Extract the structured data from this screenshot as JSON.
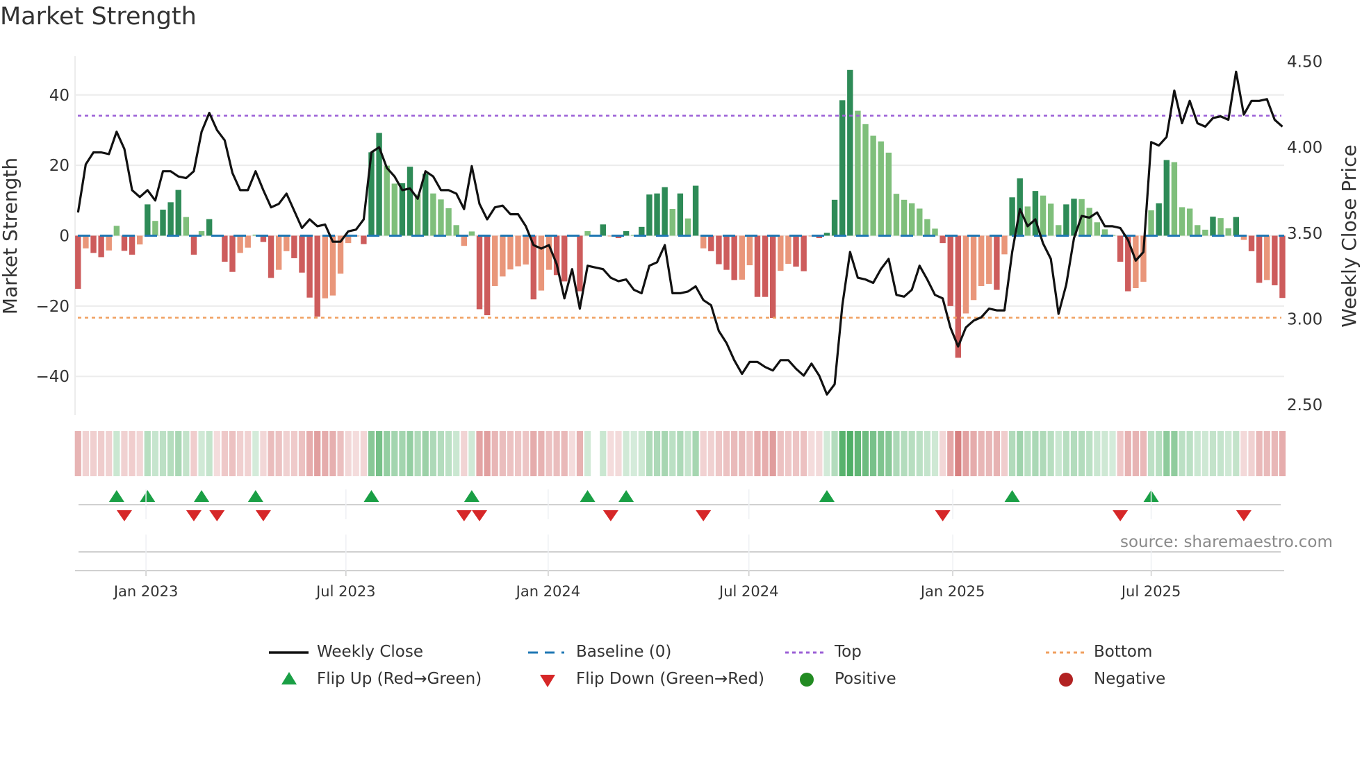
{
  "title": "Market Strength",
  "source": "source: sharemaestro.com",
  "colors": {
    "dark_green": "#2e8b57",
    "light_green": "#7fbf7b",
    "dark_red": "#cd5c5c",
    "light_red": "#e9967a",
    "line": "#111111",
    "baseline": "#1f77b4",
    "top": "#9b5fd6",
    "bottom": "#f0a060",
    "flip_up": "#1a9f45",
    "flip_down": "#d62728",
    "positive": "#228b22",
    "negative": "#b22222"
  },
  "legend": {
    "weekly_close": "Weekly Close",
    "baseline": "Baseline (0)",
    "top": "Top",
    "bottom": "Bottom",
    "flip_up": "Flip Up (Red→Green)",
    "flip_down": "Flip Down (Green→Red)",
    "positive": "Positive",
    "negative": "Negative"
  },
  "chart_data": {
    "type": "bar",
    "title": "Market Strength",
    "ylabel": "Market Strength",
    "y2label": "Weekly Close Price",
    "ylim": [
      -51,
      51
    ],
    "y2lim": [
      2.44,
      4.53
    ],
    "yticks": [
      40,
      20,
      0,
      -20,
      -40
    ],
    "ytick_labels": [
      "40",
      "20",
      "0",
      "−20",
      "−40"
    ],
    "y2ticks": [
      4.5,
      4.0,
      3.5,
      3.0,
      2.5
    ],
    "y2tick_labels": [
      "4.50",
      "4.00",
      "3.50",
      "3.00",
      "2.50"
    ],
    "x_unit": "week index",
    "xticks": [
      8.8,
      34.7,
      60.9,
      86.9,
      113.3,
      139.0
    ],
    "xtick_labels": [
      "Jan 2023",
      "Jul 2023",
      "Jan 2024",
      "Jul 2024",
      "Jan 2025",
      "Jul 2025"
    ],
    "top_threshold": 34.1,
    "bottom_threshold": -23.3,
    "baseline": 0,
    "strength": [
      -15.1,
      -3.6,
      -4.9,
      -6.1,
      -4.2,
      2.8,
      -4.3,
      -5.4,
      -2.5,
      8.9,
      4.2,
      7.4,
      9.5,
      13.0,
      5.3,
      -5.4,
      1.3,
      4.7,
      -0.3,
      -7.4,
      -10.3,
      -4.9,
      -3.4,
      0.3,
      -1.8,
      -12.0,
      -9.7,
      -4.4,
      -6.4,
      -10.5,
      -17.6,
      -23.0,
      -17.8,
      -17.0,
      -10.8,
      -2.1,
      -0.2,
      -2.4,
      23.7,
      29.2,
      19.9,
      14.8,
      14.9,
      19.6,
      11.7,
      17.6,
      12.0,
      10.3,
      7.8,
      3.0,
      -2.9,
      1.2,
      -20.9,
      -22.6,
      -14.3,
      -11.6,
      -9.6,
      -8.7,
      -8.2,
      -18.1,
      -15.6,
      -9.7,
      -11.2,
      -13.0,
      -0.3,
      -15.8,
      1.3,
      0,
      3.2,
      -0.2,
      -0.7,
      1.3,
      0.2,
      2.5,
      11.7,
      12.0,
      13.8,
      7.6,
      12.0,
      4.9,
      14.2,
      -3.6,
      -4.4,
      -8.1,
      -9.7,
      -12.6,
      -12.5,
      -8.4,
      -17.4,
      -17.4,
      -23.4,
      -10.0,
      -8.0,
      -8.8,
      -10.1,
      -0.2,
      -0.7,
      0.8,
      10.2,
      38.5,
      47.1,
      35.5,
      31.7,
      28.4,
      26.8,
      23.6,
      11.9,
      10.2,
      9.2,
      7.7,
      4.7,
      2.0,
      -2.1,
      -20.0,
      -34.7,
      -22.1,
      -18.3,
      -14.3,
      -13.7,
      -15.4,
      -5.3,
      10.9,
      16.3,
      8.3,
      12.7,
      11.4,
      9.1,
      3.0,
      8.9,
      10.5,
      10.4,
      7.9,
      3.8,
      1.8,
      0.2,
      -7.4,
      -15.8,
      -14.9,
      -13.1,
      7.2,
      9.2,
      21.5,
      20.9,
      8.1,
      7.7,
      3.0,
      1.7,
      5.4,
      5.0,
      2.1,
      5.3,
      -1.2,
      -4.4,
      -13.4,
      -12.6,
      -14.1,
      -17.7
    ],
    "weekly_close": [
      3.62,
      3.9,
      3.97,
      3.97,
      3.96,
      4.09,
      3.99,
      3.75,
      3.71,
      3.75,
      3.69,
      3.86,
      3.86,
      3.83,
      3.82,
      3.86,
      4.09,
      4.2,
      4.1,
      4.04,
      3.85,
      3.75,
      3.75,
      3.86,
      3.75,
      3.65,
      3.67,
      3.73,
      3.63,
      3.53,
      3.58,
      3.54,
      3.55,
      3.45,
      3.45,
      3.51,
      3.52,
      3.58,
      3.97,
      4.0,
      3.88,
      3.83,
      3.75,
      3.76,
      3.7,
      3.86,
      3.83,
      3.75,
      3.75,
      3.73,
      3.64,
      3.89,
      3.67,
      3.58,
      3.65,
      3.66,
      3.61,
      3.61,
      3.54,
      3.43,
      3.41,
      3.43,
      3.32,
      3.12,
      3.29,
      3.06,
      3.31,
      3.3,
      3.29,
      3.24,
      3.22,
      3.23,
      3.17,
      3.15,
      3.31,
      3.33,
      3.43,
      3.15,
      3.15,
      3.16,
      3.19,
      3.11,
      3.08,
      2.93,
      2.86,
      2.76,
      2.68,
      2.75,
      2.75,
      2.72,
      2.7,
      2.76,
      2.76,
      2.71,
      2.67,
      2.74,
      2.67,
      2.56,
      2.62,
      3.08,
      3.39,
      3.24,
      3.23,
      3.21,
      3.29,
      3.35,
      3.14,
      3.13,
      3.17,
      3.31,
      3.23,
      3.14,
      3.12,
      2.95,
      2.84,
      2.95,
      2.99,
      3.01,
      3.06,
      3.05,
      3.05,
      3.39,
      3.64,
      3.54,
      3.58,
      3.44,
      3.35,
      3.03,
      3.2,
      3.47,
      3.6,
      3.59,
      3.62,
      3.54,
      3.54,
      3.53,
      3.46,
      3.34,
      3.39,
      4.03,
      4.01,
      4.06,
      4.33,
      4.14,
      4.27,
      4.14,
      4.12,
      4.17,
      4.18,
      4.16,
      4.44,
      4.19,
      4.27,
      4.27,
      4.28,
      4.16,
      4.12
    ],
    "flip_up_weeks": [
      5,
      9,
      16,
      23,
      38,
      51,
      66,
      71,
      97,
      121,
      139
    ],
    "flip_down_weeks": [
      6,
      15,
      18,
      24,
      50,
      52,
      69,
      81,
      112,
      135,
      151
    ],
    "legend_position": "bottom"
  }
}
